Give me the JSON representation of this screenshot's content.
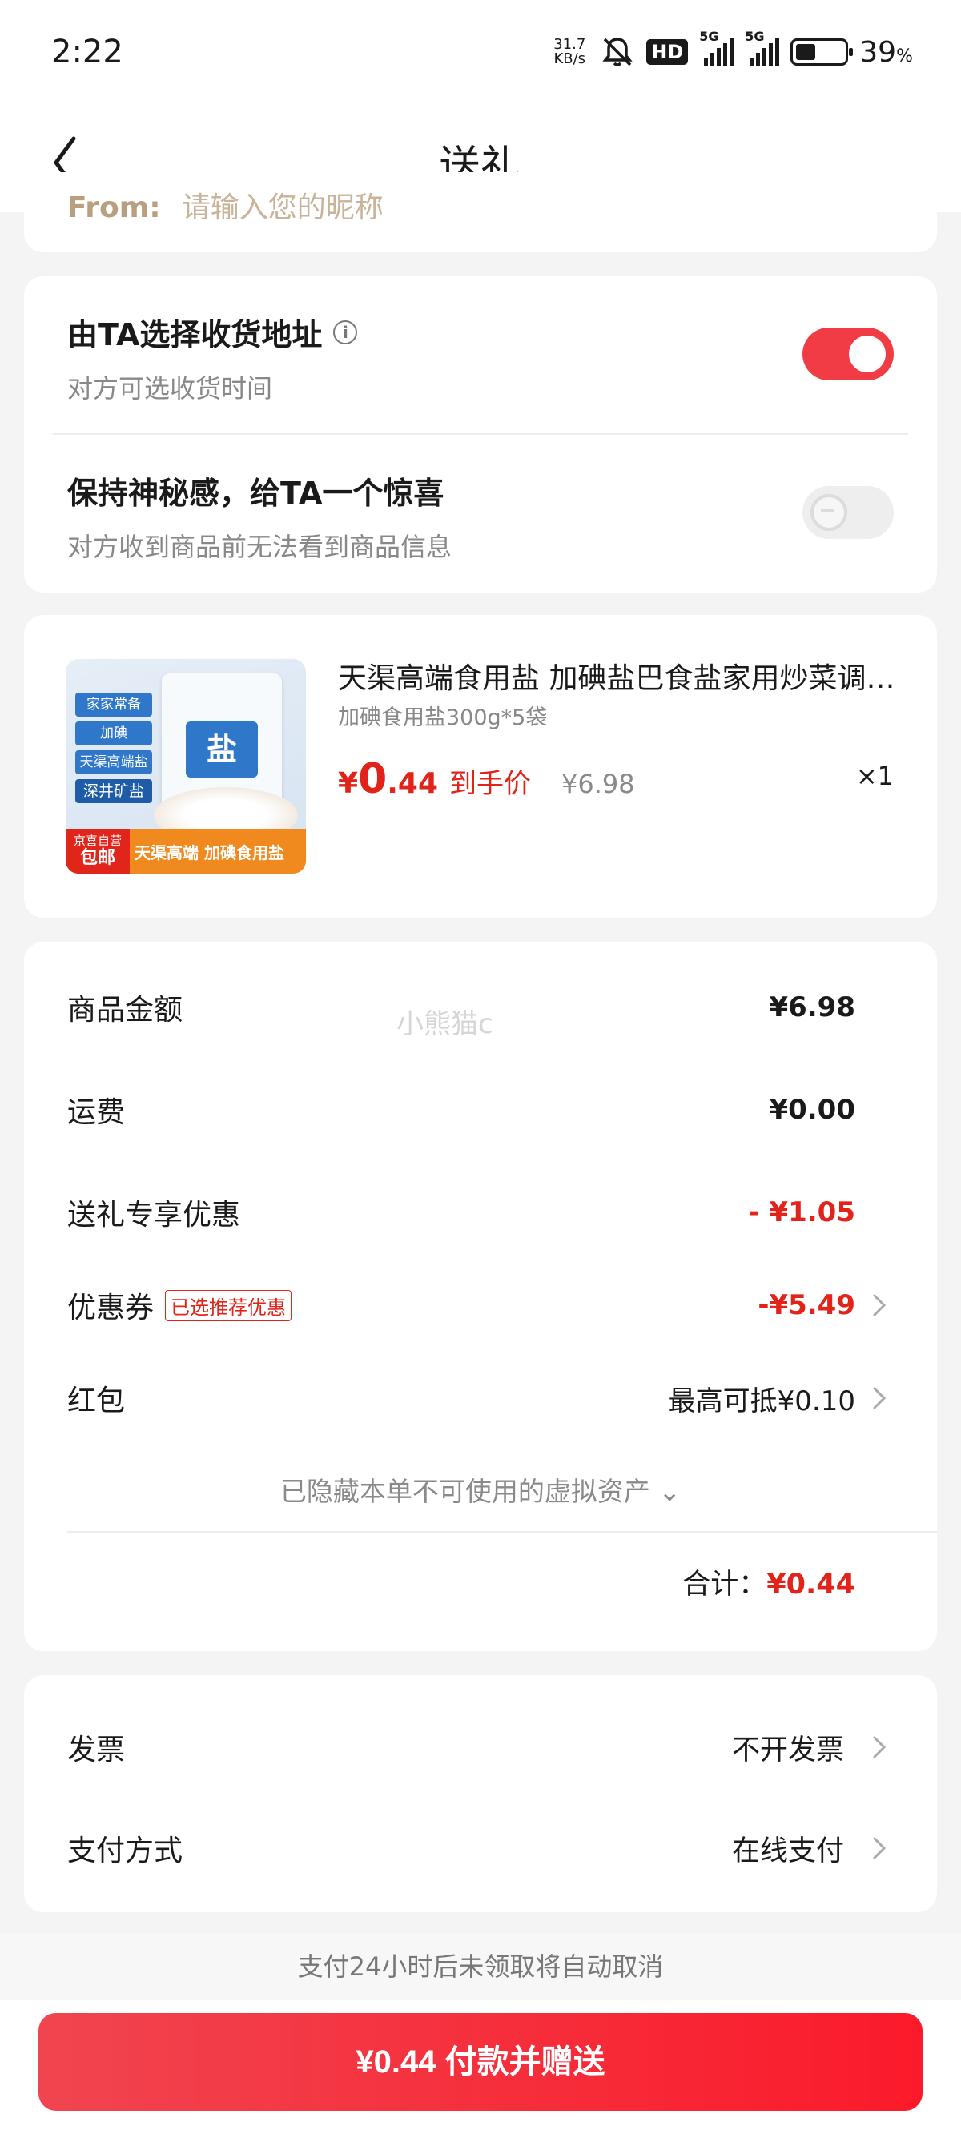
{
  "status_bar": {
    "time": "2:22",
    "net_speed_value": "31.7",
    "net_speed_unit": "KB/s",
    "hd_label": "HD",
    "signal_1_label": "5G",
    "signal_2_label": "5G",
    "battery_value": "39",
    "battery_unit": "%",
    "icons": [
      "mute-icon",
      "hd-icon",
      "signal-icon",
      "signal-icon",
      "battery-icon"
    ]
  },
  "header": {
    "title": "送礼",
    "back_icon": "chevron-left-icon"
  },
  "from_section": {
    "label": "From:",
    "placeholder": "请输入您的昵称"
  },
  "options": {
    "choose_address": {
      "title": "由TA选择收货地址",
      "subtitle": "对方可选收货时间",
      "info_icon_glyph": "i",
      "enabled": true
    },
    "keep_mystery": {
      "title": "保持神秘感，给TA一个惊喜",
      "subtitle": "对方收到商品前无法看到商品信息",
      "enabled": false
    }
  },
  "product": {
    "title": "天渠高端食用盐 加碘盐巴食盐家用炒菜调味盐",
    "spec": "加碘食用盐300g*5袋",
    "price_symbol": "¥",
    "price_int": "0",
    "price_dec": ".44",
    "price_label": "到手价",
    "original_price": "¥6.98",
    "quantity": "×1",
    "image_text": {
      "tag1": "家家常备",
      "tag2": "加碘",
      "tag3": "天渠高端盐",
      "tag4": "深井矿盐",
      "bag_label": "盐",
      "bottom_small": "京喜自营",
      "bottom_big": "包邮",
      "bottom_right": "天渠高端 加碘食用盐"
    }
  },
  "summary": {
    "watermark": "小熊猫c",
    "rows": [
      {
        "label": "商品金额",
        "value": "¥6.98"
      },
      {
        "label": "运费",
        "value": "¥0.00"
      },
      {
        "label": "送礼专享优惠",
        "value": "- ¥1.05"
      },
      {
        "label": "优惠券",
        "badge": "已选推荐优惠",
        "value": "-¥5.49"
      },
      {
        "label": "红包",
        "value": "最高可抵¥0.10"
      }
    ],
    "hidden_assets": "已隐藏本单不可使用的虚拟资产 ⌄",
    "total_label": "合计：",
    "total_value": "¥0.44"
  },
  "invoice": {
    "rows": [
      {
        "label": "发票",
        "value": "不开发票"
      },
      {
        "label": "支付方式",
        "value": "在线支付"
      }
    ]
  },
  "footer": {
    "notice": "支付24小时后未领取将自动取消",
    "pay_button": "¥0.44 付款并赠送"
  },
  "colors": {
    "accent": "#e2231a",
    "toggle_on": "#f23c45",
    "background": "#f4f4f4"
  }
}
